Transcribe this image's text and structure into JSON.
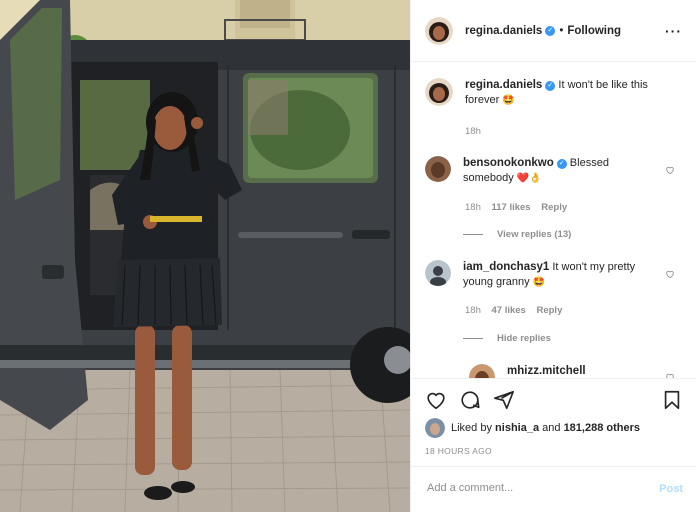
{
  "post": {
    "username": "regina.daniels",
    "following_label": "Following",
    "caption_username": "regina.daniels",
    "caption_text": "It won't be like this forever",
    "caption_emoji": "🤩",
    "caption_time": "18h"
  },
  "comments": [
    {
      "username": "bensonokonkwo",
      "verified": true,
      "text_line1": "Blessed",
      "text_line2": "somebody",
      "emoji": "❤️👌",
      "time": "18h",
      "likes": "117 likes",
      "reply_label": "Reply",
      "replies_toggle": "View replies (13)"
    },
    {
      "username": "iam_donchasy1",
      "verified": false,
      "text_line1": "It won't my pretty",
      "text_line2": "young granny",
      "emoji": "🤩",
      "time": "18h",
      "likes": "47 likes",
      "reply_label": "Reply",
      "replies_toggle": "Hide replies"
    },
    {
      "username": "mhizz.mitchell"
    }
  ],
  "likes": {
    "liked_by_prefix": "Liked by",
    "liked_by_user": "nishia_a",
    "and_label": "and",
    "others_count": "181,288 others"
  },
  "timestamp": "18 HOURS AGO",
  "add_comment": {
    "placeholder": "Add a comment...",
    "post_label": "Post"
  },
  "icons": [
    "heart-icon",
    "comment-icon",
    "share-icon",
    "bookmark-icon",
    "more-options-icon",
    "verified-badge-icon"
  ],
  "colors": {
    "accent": "#3897f0",
    "post_disabled": "#b2dffc",
    "muted": "#8e8e8e"
  }
}
